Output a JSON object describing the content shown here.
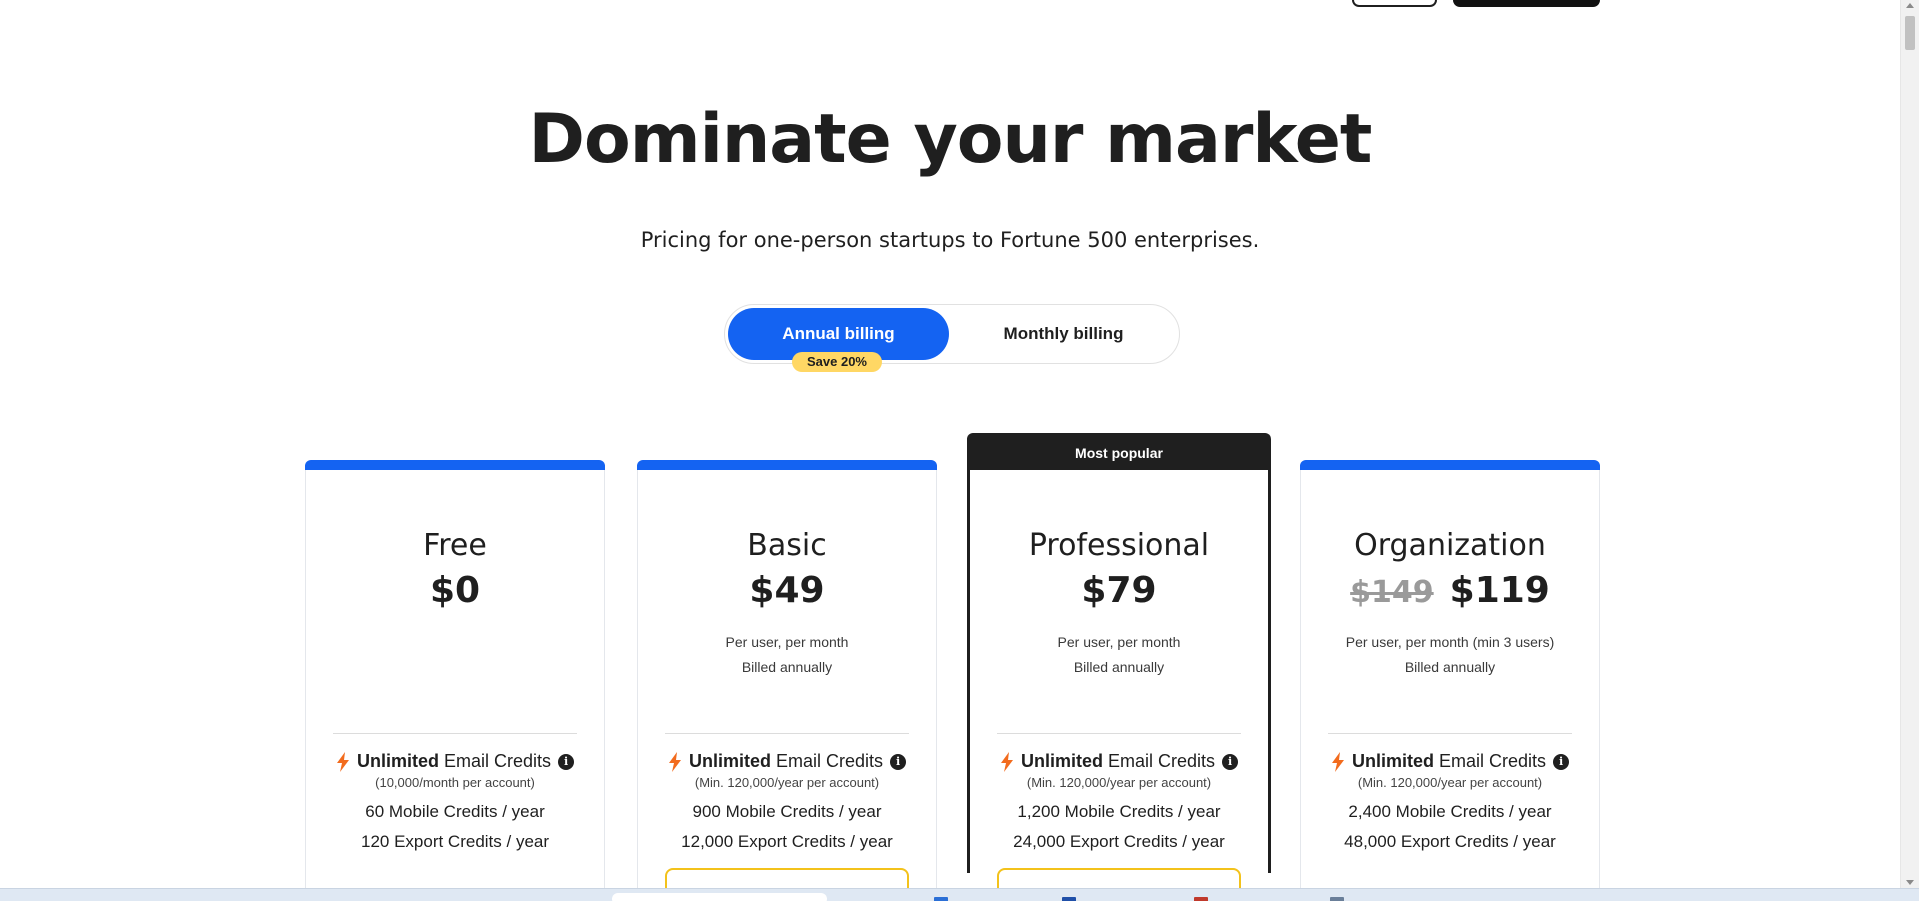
{
  "hero": {
    "title": "Dominate your market",
    "subtitle": "Pricing for one-person startups to Fortune 500 enterprises."
  },
  "billing": {
    "annual_label": "Annual billing",
    "monthly_label": "Monthly billing",
    "save_badge": "Save 20%",
    "selected": "Annual billing"
  },
  "plans": [
    {
      "name": "Free",
      "price": "$0",
      "old_price": "",
      "note_line1": "",
      "note_line2": "",
      "credits_bold": "Unlimited",
      "credits_text": "Email Credits",
      "credits_sub": "(10,000/month per account)",
      "mobile_credits": "60 Mobile Credits / year",
      "export_credits": "120 Export Credits / year"
    },
    {
      "name": "Basic",
      "price": "$49",
      "old_price": "",
      "note_line1": "Per user, per month",
      "note_line2": "Billed annually",
      "credits_bold": "Unlimited",
      "credits_text": "Email Credits",
      "credits_sub": "(Min. 120,000/year per account)",
      "mobile_credits": "900 Mobile Credits / year",
      "export_credits": "12,000 Export Credits / year"
    },
    {
      "name": "Professional",
      "badge": "Most popular",
      "price": "$79",
      "old_price": "",
      "note_line1": "Per user, per month",
      "note_line2": "Billed annually",
      "credits_bold": "Unlimited",
      "credits_text": "Email Credits",
      "credits_sub": "(Min. 120,000/year per account)",
      "mobile_credits": "1,200 Mobile Credits / year",
      "export_credits": "24,000 Export Credits / year"
    },
    {
      "name": "Organization",
      "price": "$119",
      "old_price": "$149",
      "note_line1": "Per user, per month (min 3 users)",
      "note_line2": "Billed annually",
      "credits_bold": "Unlimited",
      "credits_text": "Email Credits",
      "credits_sub": "(Min. 120,000/year per account)",
      "mobile_credits": "2,400 Mobile Credits / year",
      "export_credits": "48,000 Export Credits / year"
    }
  ],
  "colors": {
    "accent": "#1463f2",
    "badge": "#ffd764",
    "popular": "#1f1f1f",
    "bolt": "#f26b1d",
    "addon_border": "#f3c21b"
  },
  "icons": {
    "credits": "lightning-bolt-icon",
    "info": "info-icon"
  }
}
